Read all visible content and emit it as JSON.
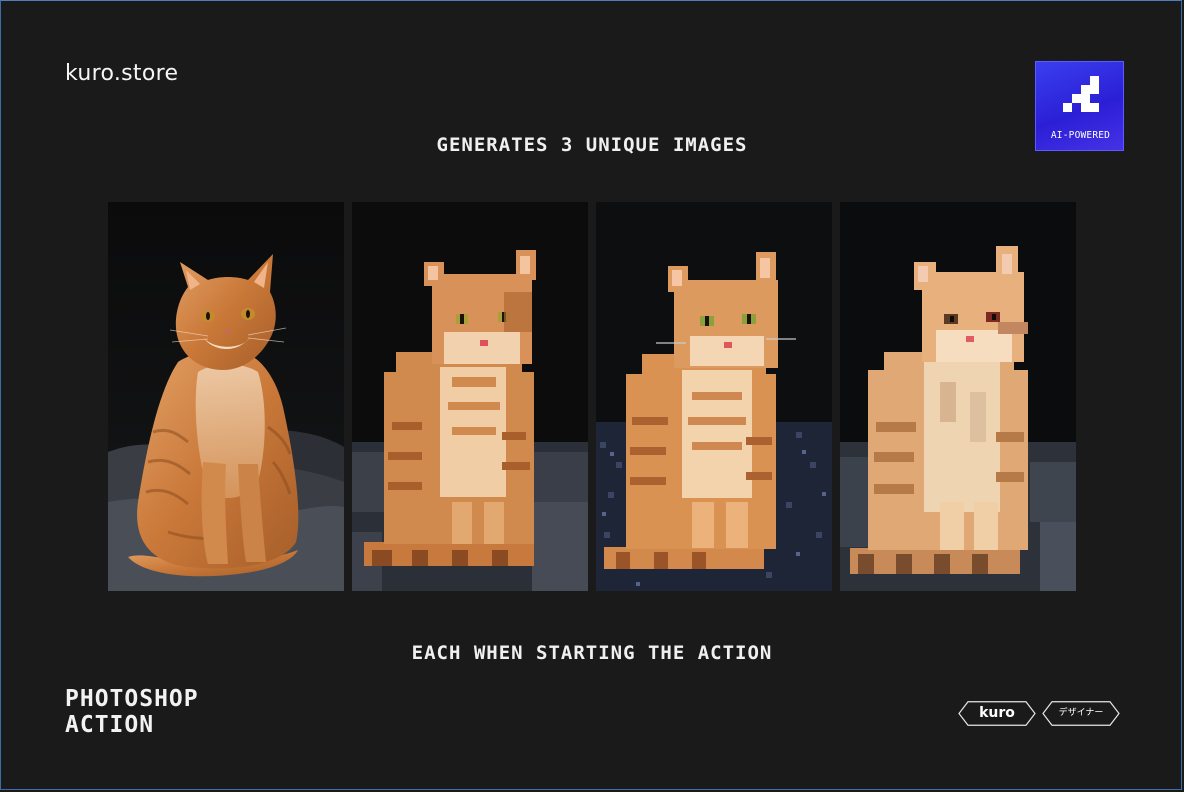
{
  "brand": "kuro.store",
  "headline_top": "GENERATES 3 UNIQUE IMAGES",
  "headline_bottom": "EACH WHEN STARTING THE ACTION",
  "badge": {
    "label": "AI-POWERED",
    "icon": "pixel-logo-icon",
    "color": "#3030e0"
  },
  "panels": [
    {
      "name": "original",
      "style": "photo",
      "icon": "cat-photo"
    },
    {
      "name": "variant-1",
      "style": "pixel-art",
      "icon": "cat-pixel"
    },
    {
      "name": "variant-2",
      "style": "pixel-art",
      "icon": "cat-pixel"
    },
    {
      "name": "variant-3",
      "style": "pixel-art",
      "icon": "cat-pixel"
    }
  ],
  "footer": {
    "line1": "PHOTOSHOP",
    "line2": "ACTION"
  },
  "tags": {
    "kuro": "kuro",
    "designer": "デザイナー"
  },
  "colors": {
    "background": "#1a1a1a",
    "text": "#f2f2f2",
    "cat_orange": "#d98a4a"
  }
}
